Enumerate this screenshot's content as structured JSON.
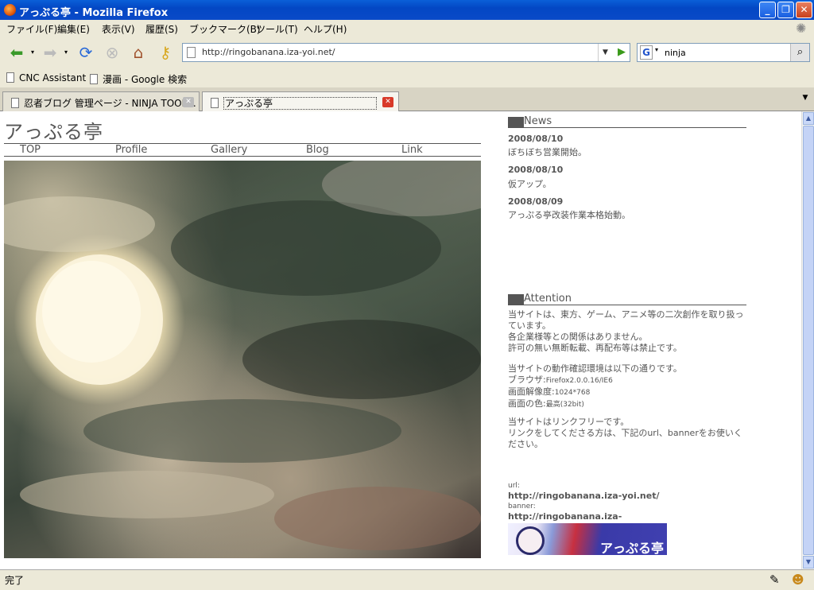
{
  "window": {
    "title": "アっぷる亭 - Mozilla Firefox"
  },
  "menu": [
    "ファイル(F)",
    "編集(E)",
    "表示(V)",
    "履歴(S)",
    "ブックマーク(B)",
    "ツール(T)",
    "ヘルプ(H)"
  ],
  "address": {
    "url": "http://ringobanana.iza-yoi.net/"
  },
  "search": {
    "engine": "G",
    "query": "ninja"
  },
  "bookmarks": [
    "CNC Assistant",
    "漫画 - Google 検索"
  ],
  "tabs": [
    {
      "label": "忍者ブログ 管理ページ - NINJA TOOL...",
      "active": false
    },
    {
      "label": "アっぷる亭",
      "active": true
    }
  ],
  "site": {
    "title": "アっぷる亭",
    "nav": [
      "TOP",
      "Profile",
      "Gallery",
      "Blog",
      "Link"
    ]
  },
  "news": {
    "heading": "News",
    "items": [
      {
        "date": "2008/08/10",
        "text": "ぼちぼち営業開始。"
      },
      {
        "date": "2008/08/10",
        "text": "仮アップ。"
      },
      {
        "date": "2008/08/09",
        "text": "アっぷる亭改装作業本格始動。"
      }
    ]
  },
  "attention": {
    "heading": "Attention",
    "p1": [
      "当サイトは、東方、ゲーム、アニメ等の二次創作を取り扱っています。",
      "各企業様等との関係はありません。",
      "許可の無い無断転載、再配布等は禁止です。"
    ],
    "p2_intro": "当サイトの動作確認環境は以下の通りです。",
    "browser_label": "ブラウザ:",
    "browser_value": "Firefox2.0.0.16/IE6",
    "resolution_label": "画面解像度:",
    "resolution_value": "1024*768",
    "color_label": "画面の色:",
    "color_value": "最高(32bit)",
    "p3": [
      "当サイトはリンクフリーです。",
      "リンクをしてくださる方は、下記のurl、bannerをお使いください。"
    ],
    "url_label": "url:",
    "url_value": "http://ringobanana.iza-yoi.net/",
    "banner_label": "banner:",
    "banner_value": "http://ringobanana.iza-yoi.net/images/banner.gif",
    "banner_text": "アっぷる亭"
  },
  "status": {
    "text": "完了"
  }
}
